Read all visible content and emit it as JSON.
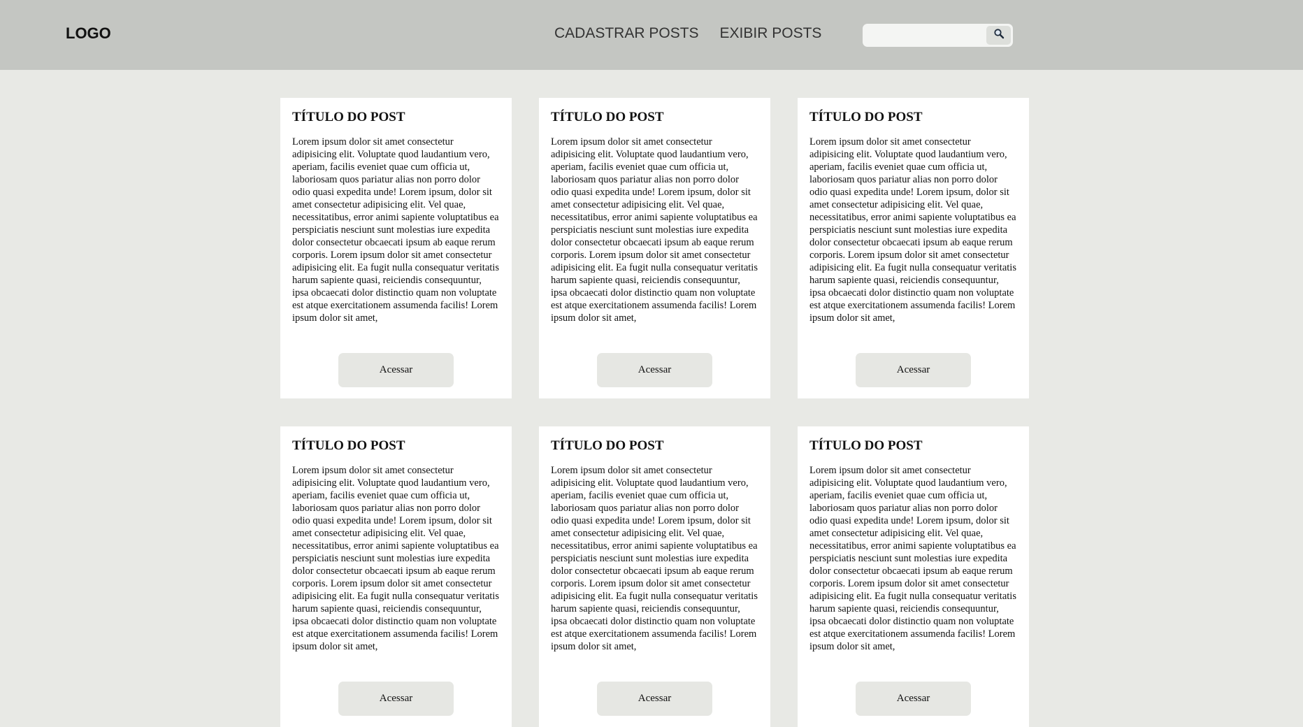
{
  "header": {
    "logo": "LOGO",
    "nav": [
      {
        "label": "CADASTRAR POSTS"
      },
      {
        "label": "EXIBIR POSTS"
      }
    ],
    "search": {
      "value": "",
      "placeholder": "",
      "button_icon": "search-icon"
    }
  },
  "posts": [
    {
      "title": "TÍTULO DO POST",
      "body": "Lorem ipsum dolor sit amet consectetur adipisicing elit. Voluptate quod laudantium vero, aperiam, facilis eveniet quae cum officia ut, laboriosam quos pariatur alias non porro dolor odio quasi expedita unde! Lorem ipsum, dolor sit amet consectetur adipisicing elit. Vel quae, necessitatibus, error animi sapiente voluptatibus ea perspiciatis nesciunt sunt molestias iure expedita dolor consectetur obcaecati ipsum ab eaque rerum corporis. Lorem ipsum dolor sit amet consectetur adipisicing elit. Ea fugit nulla consequatur veritatis harum sapiente quasi, reiciendis consequuntur, ipsa obcaecati dolor distinctio quam non voluptate est atque exercitationem assumenda facilis! Lorem ipsum dolor sit amet,",
      "button": "Acessar"
    },
    {
      "title": "TÍTULO DO POST",
      "body": "Lorem ipsum dolor sit amet consectetur adipisicing elit. Voluptate quod laudantium vero, aperiam, facilis eveniet quae cum officia ut, laboriosam quos pariatur alias non porro dolor odio quasi expedita unde! Lorem ipsum, dolor sit amet consectetur adipisicing elit. Vel quae, necessitatibus, error animi sapiente voluptatibus ea perspiciatis nesciunt sunt molestias iure expedita dolor consectetur obcaecati ipsum ab eaque rerum corporis. Lorem ipsum dolor sit amet consectetur adipisicing elit. Ea fugit nulla consequatur veritatis harum sapiente quasi, reiciendis consequuntur, ipsa obcaecati dolor distinctio quam non voluptate est atque exercitationem assumenda facilis! Lorem ipsum dolor sit amet,",
      "button": "Acessar"
    },
    {
      "title": "TÍTULO DO POST",
      "body": "Lorem ipsum dolor sit amet consectetur adipisicing elit. Voluptate quod laudantium vero, aperiam, facilis eveniet quae cum officia ut, laboriosam quos pariatur alias non porro dolor odio quasi expedita unde! Lorem ipsum, dolor sit amet consectetur adipisicing elit. Vel quae, necessitatibus, error animi sapiente voluptatibus ea perspiciatis nesciunt sunt molestias iure expedita dolor consectetur obcaecati ipsum ab eaque rerum corporis. Lorem ipsum dolor sit amet consectetur adipisicing elit. Ea fugit nulla consequatur veritatis harum sapiente quasi, reiciendis consequuntur, ipsa obcaecati dolor distinctio quam non voluptate est atque exercitationem assumenda facilis! Lorem ipsum dolor sit amet,",
      "button": "Acessar"
    },
    {
      "title": "TÍTULO DO POST",
      "body": "Lorem ipsum dolor sit amet consectetur adipisicing elit. Voluptate quod laudantium vero, aperiam, facilis eveniet quae cum officia ut, laboriosam quos pariatur alias non porro dolor odio quasi expedita unde! Lorem ipsum, dolor sit amet consectetur adipisicing elit. Vel quae, necessitatibus, error animi sapiente voluptatibus ea perspiciatis nesciunt sunt molestias iure expedita dolor consectetur obcaecati ipsum ab eaque rerum corporis. Lorem ipsum dolor sit amet consectetur adipisicing elit. Ea fugit nulla consequatur veritatis harum sapiente quasi, reiciendis consequuntur, ipsa obcaecati dolor distinctio quam non voluptate est atque exercitationem assumenda facilis! Lorem ipsum dolor sit amet,",
      "button": "Acessar"
    },
    {
      "title": "TÍTULO DO POST",
      "body": "Lorem ipsum dolor sit amet consectetur adipisicing elit. Voluptate quod laudantium vero, aperiam, facilis eveniet quae cum officia ut, laboriosam quos pariatur alias non porro dolor odio quasi expedita unde! Lorem ipsum, dolor sit amet consectetur adipisicing elit. Vel quae, necessitatibus, error animi sapiente voluptatibus ea perspiciatis nesciunt sunt molestias iure expedita dolor consectetur obcaecati ipsum ab eaque rerum corporis. Lorem ipsum dolor sit amet consectetur adipisicing elit. Ea fugit nulla consequatur veritatis harum sapiente quasi, reiciendis consequuntur, ipsa obcaecati dolor distinctio quam non voluptate est atque exercitationem assumenda facilis! Lorem ipsum dolor sit amet,",
      "button": "Acessar"
    },
    {
      "title": "TÍTULO DO POST",
      "body": "Lorem ipsum dolor sit amet consectetur adipisicing elit. Voluptate quod laudantium vero, aperiam, facilis eveniet quae cum officia ut, laboriosam quos pariatur alias non porro dolor odio quasi expedita unde! Lorem ipsum, dolor sit amet consectetur adipisicing elit. Vel quae, necessitatibus, error animi sapiente voluptatibus ea perspiciatis nesciunt sunt molestias iure expedita dolor consectetur obcaecati ipsum ab eaque rerum corporis. Lorem ipsum dolor sit amet consectetur adipisicing elit. Ea fugit nulla consequatur veritatis harum sapiente quasi, reiciendis consequuntur, ipsa obcaecati dolor distinctio quam non voluptate est atque exercitationem assumenda facilis! Lorem ipsum dolor sit amet,",
      "button": "Acessar"
    }
  ],
  "colors": {
    "header_bg": "#c4c6c2",
    "page_bg": "#e8e9e5",
    "card_bg": "#ffffff",
    "button_bg": "#e6e7e3"
  }
}
